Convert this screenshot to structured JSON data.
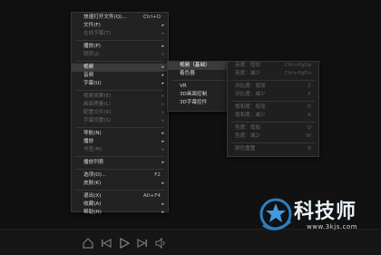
{
  "main_menu": {
    "items": [
      {
        "label": "快速打开文件(Q)...",
        "shortcut": "Ctrl+O",
        "state": "normal"
      },
      {
        "label": "文件(F)",
        "arrow": "▸",
        "state": "normal"
      },
      {
        "label": "在线字幕(T)",
        "arrow": "▸",
        "state": "disabled"
      },
      {
        "sep": true
      },
      {
        "label": "播放(P)",
        "arrow": "▸",
        "state": "normal"
      },
      {
        "label": "跳转(J)",
        "arrow": "▸",
        "state": "disabled"
      },
      {
        "sep": true
      },
      {
        "label": "视频",
        "arrow": "▸",
        "state": "active"
      },
      {
        "label": "音频",
        "arrow": "▸",
        "state": "normal"
      },
      {
        "label": "字幕(U)",
        "arrow": "▸",
        "state": "normal"
      },
      {
        "sep": true
      },
      {
        "label": "视频效果(E)",
        "arrow": "▸",
        "state": "disabled"
      },
      {
        "label": "画面质量(L)",
        "arrow": "▸",
        "state": "disabled"
      },
      {
        "label": "配置文件(R)",
        "arrow": "▸",
        "state": "disabled"
      },
      {
        "label": "字幕设置(S)",
        "arrow": "▸",
        "state": "disabled"
      },
      {
        "sep": true
      },
      {
        "label": "导航(N)",
        "arrow": "▸",
        "state": "normal"
      },
      {
        "label": "播放",
        "arrow": "▸",
        "state": "normal"
      },
      {
        "label": "书签(M)",
        "arrow": "▸",
        "state": "disabled"
      },
      {
        "sep": true
      },
      {
        "label": "播放列表",
        "arrow": "▸",
        "state": "normal"
      },
      {
        "sep": true
      },
      {
        "label": "选项(O)...",
        "shortcut": "F2",
        "state": "normal"
      },
      {
        "label": "皮肤(K)",
        "arrow": "▸",
        "state": "normal"
      },
      {
        "sep": true
      },
      {
        "label": "退出(X)",
        "shortcut": "Alt+F4",
        "state": "normal"
      },
      {
        "label": "收藏(A)",
        "arrow": "▸",
        "state": "normal"
      },
      {
        "label": "帮助(H)",
        "arrow": "▸",
        "state": "normal"
      }
    ]
  },
  "video_submenu": {
    "items": [
      {
        "label": "视频（基础）",
        "arrow": "▸",
        "state": "active"
      },
      {
        "label": "着色器",
        "arrow": "▸",
        "state": "normal"
      },
      {
        "sep": true
      },
      {
        "label": "VR",
        "arrow": "▸",
        "state": "normal"
      },
      {
        "label": "3D画面控制",
        "arrow": "▸",
        "state": "normal"
      },
      {
        "label": "3D字幕控件",
        "arrow": "▸",
        "state": "normal"
      }
    ]
  },
  "basic_submenu": {
    "items": [
      {
        "label": "亮度：增加",
        "shortcut": "Ctrl+PgUp",
        "state": "disabled"
      },
      {
        "label": "亮度：减少",
        "shortcut": "Ctrl+PgDn",
        "state": "disabled"
      },
      {
        "sep": true
      },
      {
        "label": "对比度：增加",
        "shortcut": "Z",
        "state": "disabled"
      },
      {
        "label": "对比度：减少",
        "shortcut": "X",
        "state": "disabled"
      },
      {
        "sep": true
      },
      {
        "label": "饱和度：增加",
        "shortcut": "D",
        "state": "disabled"
      },
      {
        "label": "饱和度：减少",
        "shortcut": "A",
        "state": "disabled"
      },
      {
        "sep": true
      },
      {
        "label": "色度：增加",
        "shortcut": "Q",
        "state": "disabled"
      },
      {
        "label": "色度：减少",
        "shortcut": "W",
        "state": "disabled"
      },
      {
        "sep": true
      },
      {
        "label": "颜色重置",
        "shortcut": "E",
        "state": "disabled"
      }
    ]
  },
  "watermark": {
    "title": "科技师",
    "url": "www.3kjs.com"
  },
  "colors": {
    "menu_bg": "#222222",
    "active_bg": "#3b3b3b",
    "disabled_text": "#6a6a6a",
    "logo_blue": "#2a7fc1"
  }
}
